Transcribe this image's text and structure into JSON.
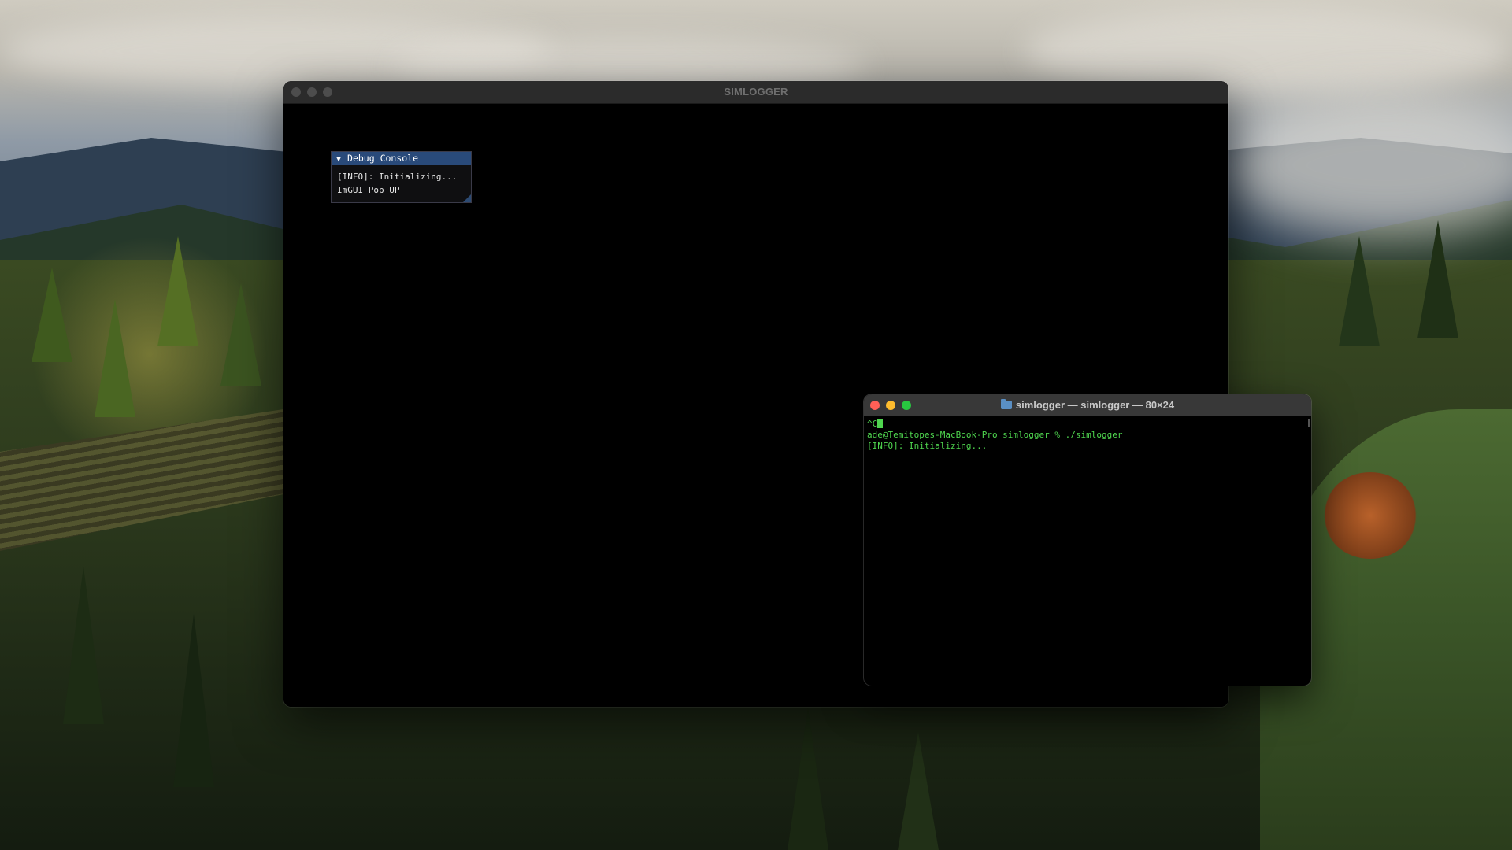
{
  "simlogger_window": {
    "title": "SIMLOGGER",
    "debug_console": {
      "title": "Debug Console",
      "collapse_arrow": "▼",
      "lines": [
        "[INFO]: Initializing...",
        "ImGUI Pop UP"
      ]
    }
  },
  "terminal_window": {
    "title": "simlogger — simlogger — 80×24",
    "folder_icon": "folder-icon",
    "lines": [
      "^C",
      "ade@Temitopes-MacBook-Pro simlogger % ./simlogger",
      "[INFO]: Initializing..."
    ],
    "text_color": "#4fd64f"
  },
  "colors": {
    "close": "#ff5f57",
    "minimize": "#febc2e",
    "maximize": "#28c840",
    "imgui_title": "#294a7a"
  }
}
